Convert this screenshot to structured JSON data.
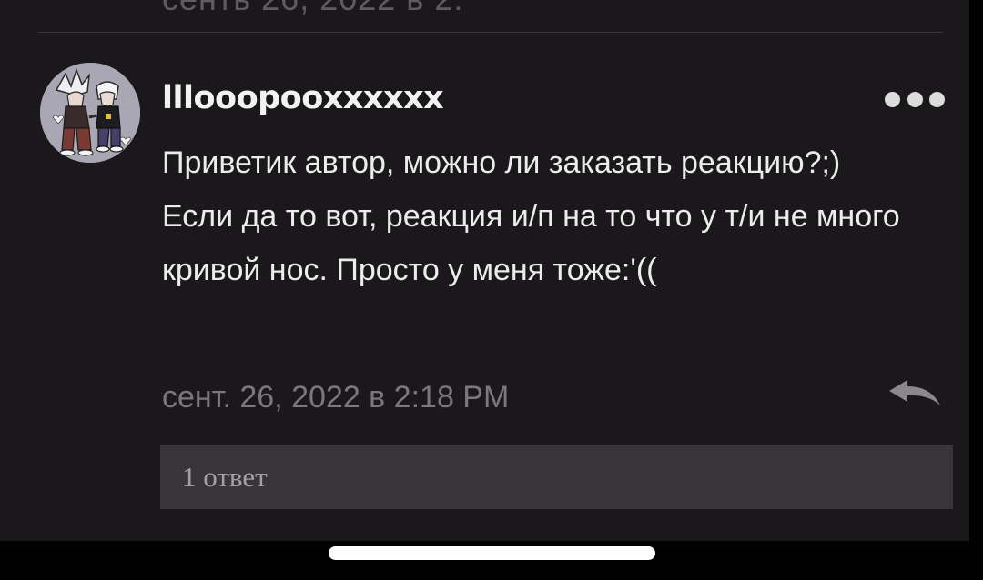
{
  "previous_comment": {
    "text_fragment": "сенть 26, 2022 в 2:"
  },
  "comment": {
    "author": "lllooopooxxxxxx",
    "body": "Приветик автор, можно ли заказать реакцию?;) Если да то вот, реакция и/п на то что у т/и не много кривой нос. Просто у меня тоже:'((",
    "timestamp": "сент. 26, 2022 в 2:18 PM",
    "replies_label": "1 ответ"
  },
  "icons": {
    "more": "more-options-icon",
    "reply": "reply-arrow-icon"
  },
  "colors": {
    "background": "#1a181a",
    "text_primary": "#ececec",
    "text_muted": "#7a787a",
    "replies_bar": "#373537"
  }
}
